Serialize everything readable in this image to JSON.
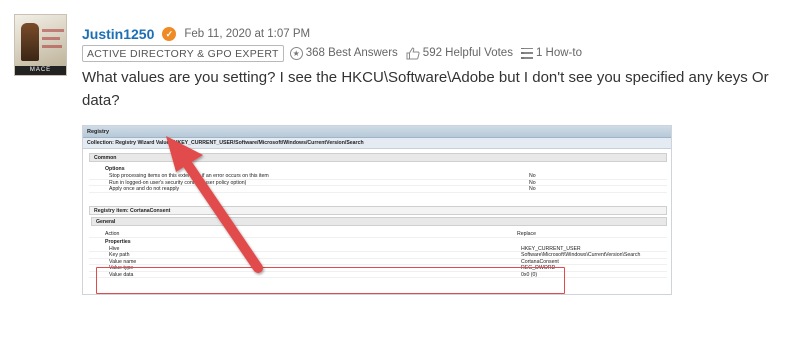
{
  "post": {
    "username": "Justin1250",
    "date": "Feb 11, 2020 at 1:07 PM",
    "badge": "ACTIVE DIRECTORY & GPO EXPERT",
    "best_answers": "368 Best Answers",
    "helpful_votes": "592 Helpful Votes",
    "how_to": "1 How-to",
    "question": "What values are you setting? I see the HKCU\\Software\\Adobe but I don't see you specified any keys Or data?",
    "avatar_caption": "MACE"
  },
  "icons": {
    "verified": "check-badge-icon",
    "best_answers": "star-circle-icon",
    "helpful_votes": "thumbs-up-icon",
    "how_to": "list-icon"
  },
  "screenshot": {
    "title": "Registry",
    "collection": "Collection: Registry Wizard Values/HKEY_CURRENT_USER/Software/Microsoft/Windows/CurrentVersion/Search",
    "common": {
      "header": "Common",
      "options_label": "Options",
      "rows": [
        {
          "k": "Stop processing items on this extension if an error occurs on this item",
          "v": "No"
        },
        {
          "k": "Run in logged-on user's security context (user policy option)",
          "v": "No"
        },
        {
          "k": "Apply once and do not reapply",
          "v": "No"
        }
      ]
    },
    "item": {
      "header": "Registry item: CortanaConsent",
      "general": "General",
      "action_label": "Action",
      "action_value": "Replace",
      "properties_label": "Properties",
      "rows": [
        {
          "k": "Hive",
          "v": "HKEY_CURRENT_USER"
        },
        {
          "k": "Key path",
          "v": "Software\\Microsoft\\Windows\\CurrentVersion\\Search"
        },
        {
          "k": "Value name",
          "v": "CortanaConsent"
        },
        {
          "k": "Value type",
          "v": "REG_DWORD"
        },
        {
          "k": "Value data",
          "v": "0x0 (0)"
        }
      ]
    }
  },
  "colors": {
    "username": "#1b6fb5",
    "verified": "#f08a24",
    "annotation": "#e24b4b"
  }
}
